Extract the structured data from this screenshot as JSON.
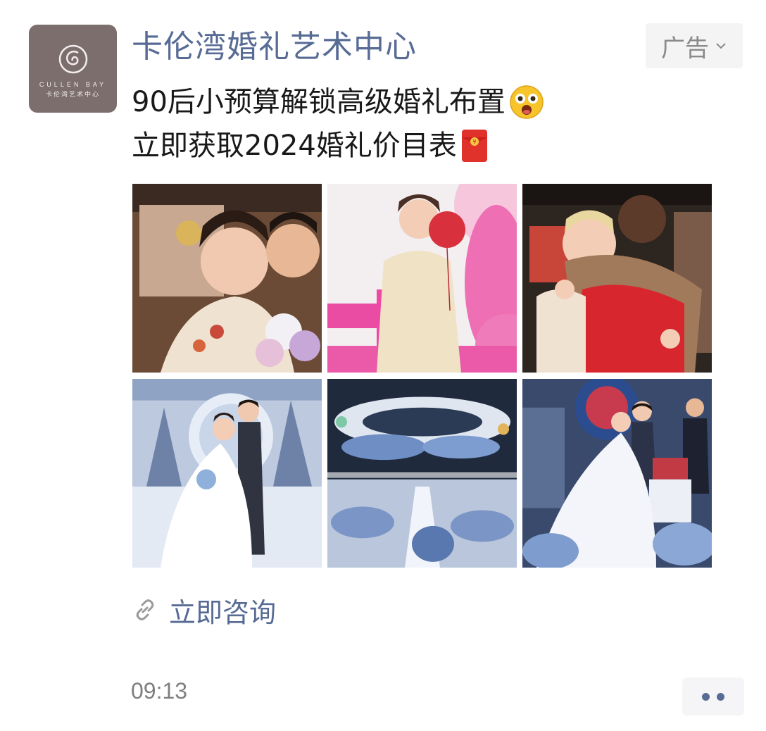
{
  "account": {
    "name": "卡伦湾婚礼艺术中心",
    "avatar_brand_en": "CULLEN BAY",
    "avatar_brand_cn": "卡伦湾艺术中心"
  },
  "ad_tag": {
    "label": "广告",
    "icon": "chevron-down-icon"
  },
  "post": {
    "line1": "90后小预算解锁高级婚礼布置",
    "line1_emoji": "astonished-face-emoji",
    "line2": "立即获取2024婚礼价目表",
    "line2_emoji": "red-envelope-emoji"
  },
  "photos": [
    {
      "name": "photo-bride-groom-car"
    },
    {
      "name": "photo-bride-red-balloon"
    },
    {
      "name": "photo-bride-hug-mother"
    },
    {
      "name": "photo-couple-blue-stage"
    },
    {
      "name": "photo-banquet-hall"
    },
    {
      "name": "photo-cake-cutting"
    }
  ],
  "link": {
    "label": "立即咨询",
    "icon": "link-icon"
  },
  "footer": {
    "time": "09:13",
    "more_icon": "more-dots-icon"
  },
  "colors": {
    "link_blue": "#576b95",
    "text": "#191919",
    "muted": "#7f7f7f"
  }
}
